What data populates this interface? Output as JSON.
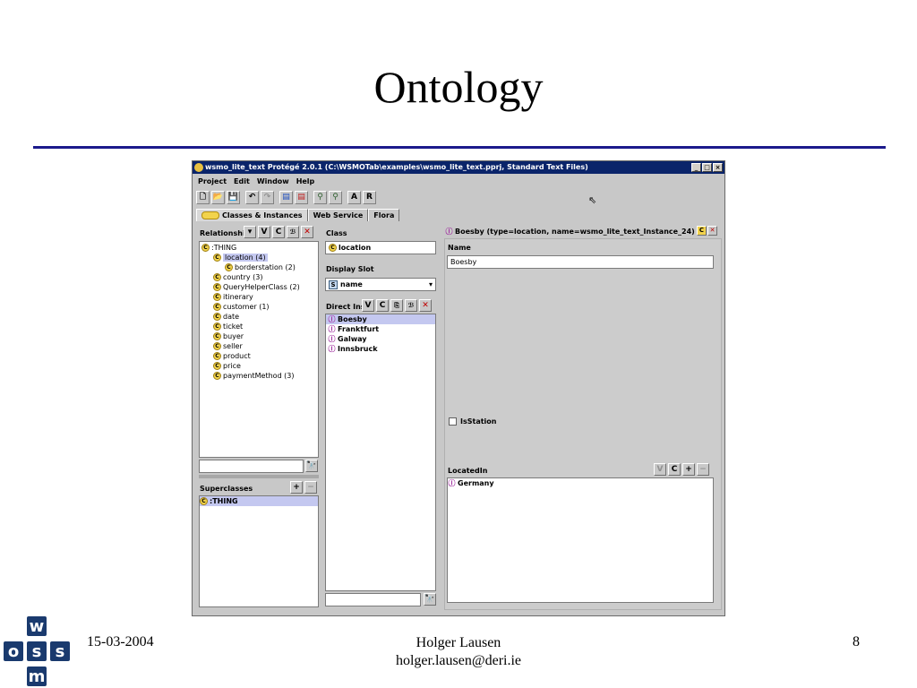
{
  "slide": {
    "title": "Ontology",
    "footer_date": "15-03-2004",
    "footer_author": "Holger Lausen",
    "footer_email": "holger.lausen@deri.ie",
    "page_number": "8"
  },
  "logo": {
    "top": "w",
    "left": "o",
    "middle": "s",
    "right": "s",
    "bottom": "m"
  },
  "window": {
    "title": "wsmo_lite_text  Protégé 2.0.1    (C:\\WSMOTab\\examples\\wsmo_lite_text.pprj, Standard Text Files)",
    "buttons": [
      "_",
      "□",
      "×"
    ]
  },
  "menu": [
    "Project",
    "Edit",
    "Window",
    "Help"
  ],
  "toolbar": {
    "a_label": "A",
    "r_label": "R"
  },
  "tabs": [
    "Classes & Instances",
    "Web Service",
    "Flora"
  ],
  "class_pane": {
    "header": "Relationship",
    "btn_v": "V",
    "btn_c": "C",
    "tree": [
      {
        "label": ":THING",
        "indent": 0,
        "selected": false
      },
      {
        "label": "location  (4)",
        "indent": 1,
        "selected": true
      },
      {
        "label": "borderstation  (2)",
        "indent": 2,
        "selected": false
      },
      {
        "label": "country  (3)",
        "indent": 1,
        "selected": false
      },
      {
        "label": "QueryHelperClass  (2)",
        "indent": 1,
        "selected": false
      },
      {
        "label": "itinerary",
        "indent": 1,
        "selected": false
      },
      {
        "label": "customer  (1)",
        "indent": 1,
        "selected": false
      },
      {
        "label": "date",
        "indent": 1,
        "selected": false
      },
      {
        "label": "ticket",
        "indent": 1,
        "selected": false
      },
      {
        "label": "buyer",
        "indent": 1,
        "selected": false
      },
      {
        "label": "seller",
        "indent": 1,
        "selected": false
      },
      {
        "label": "product",
        "indent": 1,
        "selected": false
      },
      {
        "label": "price",
        "indent": 1,
        "selected": false
      },
      {
        "label": "paymentMethod  (3)",
        "indent": 1,
        "selected": false
      }
    ],
    "superclasses_header": "Superclasses",
    "superclasses": [
      ":THING"
    ]
  },
  "instance_pane": {
    "class_label": "Class",
    "class_value": "location",
    "display_slot_label": "Display Slot",
    "display_slot_value": "name",
    "direct_instances_label": "Direct Inst",
    "instances": [
      "Boesby",
      "Franktfurt",
      "Galway",
      "Innsbruck"
    ]
  },
  "form_pane": {
    "header": "Boesby    (type=location, name=wsmo_lite_text_Instance_24)",
    "name_label": "Name",
    "name_value": "Boesby",
    "isstation_label": "IsStation",
    "locatedin_label": "LocatedIn",
    "locatedin_values": [
      "Germany"
    ]
  }
}
